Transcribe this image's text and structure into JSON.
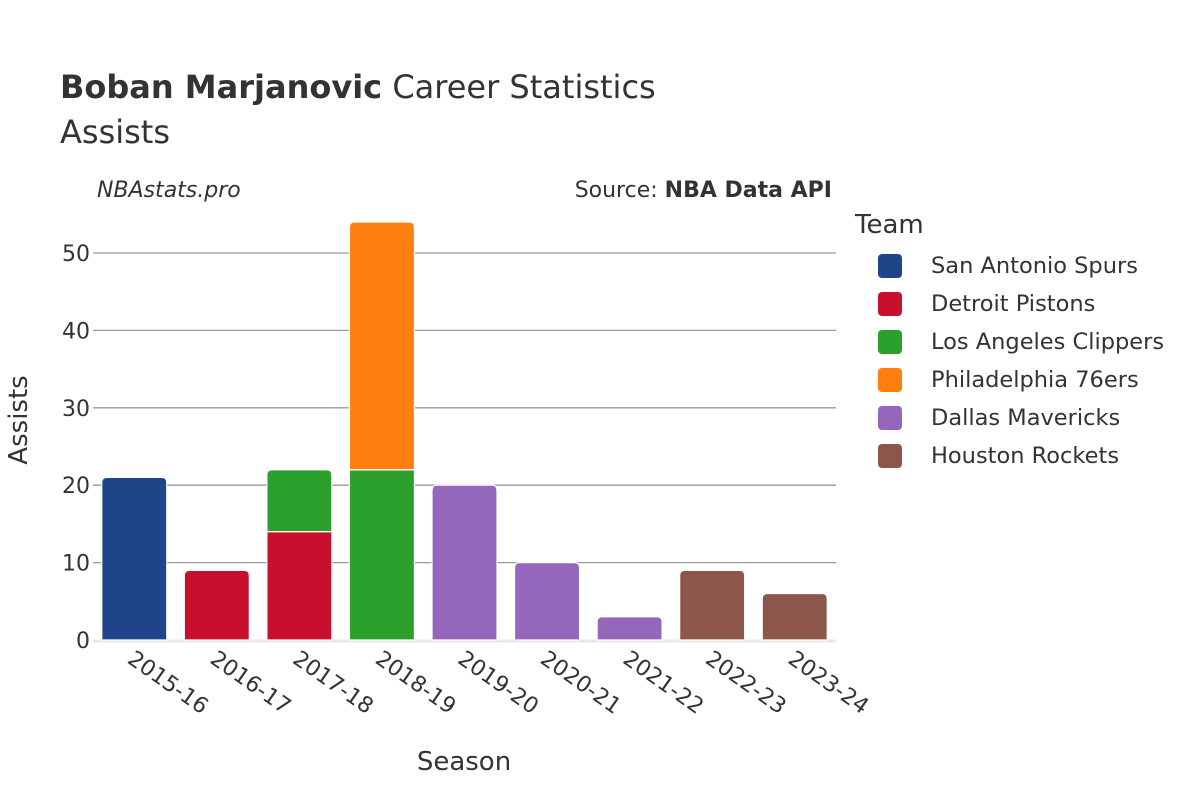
{
  "header": {
    "title_bold": "Boban Marjanovic",
    "title_rest": " Career Statistics",
    "subtitle": "Assists",
    "brand": "NBAstats.pro",
    "source_label": "Source: ",
    "source_value": "NBA Data API"
  },
  "legend": {
    "title": "Team",
    "items": [
      {
        "label": "San Antonio Spurs",
        "color": "#1f448a"
      },
      {
        "label": "Detroit Pistons",
        "color": "#c8102e"
      },
      {
        "label": "Los Angeles Clippers",
        "color": "#2ca02c"
      },
      {
        "label": "Philadelphia 76ers",
        "color": "#ff7f0e"
      },
      {
        "label": "Dallas Mavericks",
        "color": "#9467bd"
      },
      {
        "label": "Houston Rockets",
        "color": "#8c564b"
      }
    ]
  },
  "chart_data": {
    "type": "bar",
    "stacked": true,
    "title": "Boban Marjanovic Career Statistics",
    "subtitle": "Assists",
    "xlabel": "Season",
    "ylabel": "Assists",
    "ylim": [
      0,
      55
    ],
    "yticks": [
      0,
      10,
      20,
      30,
      40,
      50
    ],
    "grid": true,
    "legend_position": "right",
    "categories": [
      "2015-16",
      "2016-17",
      "2017-18",
      "2018-19",
      "2019-20",
      "2020-21",
      "2021-22",
      "2022-23",
      "2023-24"
    ],
    "series": [
      {
        "name": "San Antonio Spurs",
        "color": "#1f448a",
        "values": [
          21,
          0,
          0,
          0,
          0,
          0,
          0,
          0,
          0
        ]
      },
      {
        "name": "Detroit Pistons",
        "color": "#c8102e",
        "values": [
          0,
          9,
          14,
          0,
          0,
          0,
          0,
          0,
          0
        ]
      },
      {
        "name": "Los Angeles Clippers",
        "color": "#2ca02c",
        "values": [
          0,
          0,
          8,
          22,
          0,
          0,
          0,
          0,
          0
        ]
      },
      {
        "name": "Philadelphia 76ers",
        "color": "#ff7f0e",
        "values": [
          0,
          0,
          0,
          32,
          0,
          0,
          0,
          0,
          0
        ]
      },
      {
        "name": "Dallas Mavericks",
        "color": "#9467bd",
        "values": [
          0,
          0,
          0,
          0,
          20,
          10,
          3,
          0,
          0
        ]
      },
      {
        "name": "Houston Rockets",
        "color": "#8c564b",
        "values": [
          0,
          0,
          0,
          0,
          0,
          0,
          0,
          9,
          6
        ]
      }
    ]
  }
}
